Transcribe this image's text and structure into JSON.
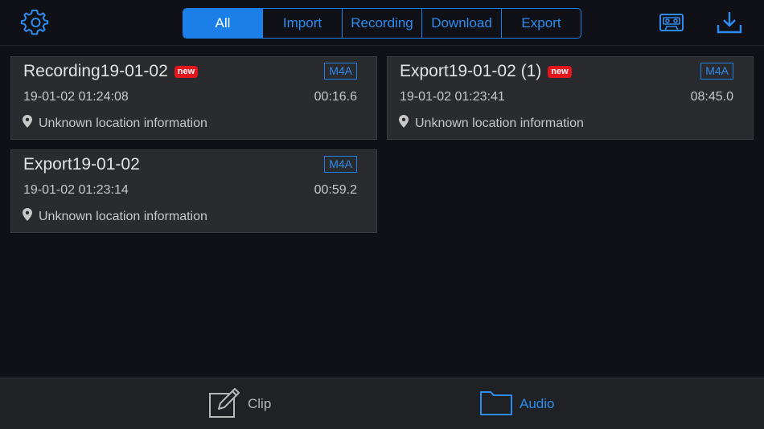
{
  "toolbar": {
    "settings_icon": "gear-icon",
    "cassette_icon": "cassette-icon",
    "download_icon": "download-icon"
  },
  "filter_tabs": [
    {
      "label": "All",
      "selected": true
    },
    {
      "label": "Import",
      "selected": false
    },
    {
      "label": "Recording",
      "selected": false
    },
    {
      "label": "Download",
      "selected": false
    },
    {
      "label": "Export",
      "selected": false
    }
  ],
  "recordings": [
    {
      "title": "Recording19-01-02",
      "is_new": true,
      "new_label": "new",
      "format": "M4A",
      "date": "19-01-02 01:24:08",
      "duration": "00:16.6",
      "location": "Unknown location information"
    },
    {
      "title": "Export19-01-02 (1)",
      "is_new": true,
      "new_label": "new",
      "format": "M4A",
      "date": "19-01-02 01:23:41",
      "duration": "08:45.0",
      "location": "Unknown location information"
    },
    {
      "title": "Export19-01-02",
      "is_new": false,
      "new_label": "",
      "format": "M4A",
      "date": "19-01-02 01:23:14",
      "duration": "00:59.2",
      "location": "Unknown location information"
    }
  ],
  "bottom_tabs": [
    {
      "label": "Clip",
      "icon": "edit-icon",
      "active": false
    },
    {
      "label": "Audio",
      "icon": "folder-icon",
      "active": true
    }
  ],
  "colors": {
    "accent": "#1a7fe8",
    "badge_red": "#e2161c",
    "card_bg": "#2a2b2e",
    "background": "#0f1116"
  }
}
